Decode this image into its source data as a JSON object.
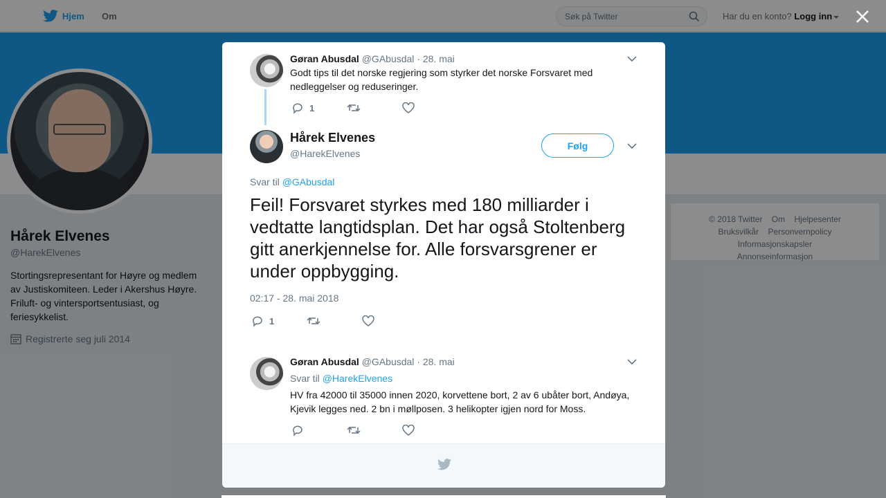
{
  "topbar": {
    "home_label": "Hjem",
    "about_label": "Om",
    "search_placeholder": "Søk på Twitter",
    "account_prompt": "Har du en konto?",
    "login_label": "Logg inn"
  },
  "profile": {
    "name": "Hårek Elvenes",
    "handle": "@HarekElvenes",
    "bio": "Stortingsrepresentant for Høyre og medlem av Justiskomiteen. Leder i Akershus Høyre. Friluft- og vintersportsentusiast, og feriesykkelist.",
    "joined": "Registrerte seg juli 2014"
  },
  "footer_links": [
    "© 2018 Twitter",
    "Om",
    "Hjelpesenter",
    "Bruksvilkår",
    "Personvernpolicy",
    "Informasjonskapsler",
    "Annonseinformasjon"
  ],
  "parent_tweet": {
    "name": "Gøran Abusdal",
    "handle": "@GAbusdal",
    "sep_date": "· 28. mai",
    "text": "Godt tips til det norske regjering som styrker det norske Forsvaret med nedleggelser og reduseringer.",
    "reply_count": "1"
  },
  "main_tweet": {
    "name": "Hårek Elvenes",
    "handle": "@HarekElvenes",
    "follow_label": "Følg",
    "reply_prefix": "Svar til",
    "reply_handle": "@GAbusdal",
    "text": "Feil! Forsvaret styrkes med 180 milliarder i vedtatte langtidsplan. Det har også Stoltenberg gitt anerkjennelse for. Alle forsvarsgrener er under oppbygging.",
    "timestamp": "02:17 - 28. mai 2018",
    "reply_count": "1"
  },
  "reply_tweet": {
    "name": "Gøran Abusdal",
    "handle": "@GAbusdal",
    "sep_date": "· 28. mai",
    "reply_prefix": "Svar til",
    "reply_handle": "@HarekElvenes",
    "text": "HV fra 42000 til 35000 innen 2020, korvettene bort, 2 av 6 ubåter bort, Andøya, Kjevik legges ned. 2 bn i møllposen. 3 helikopter igjen nord for Moss."
  },
  "colors": {
    "brand": "#1da1f2",
    "thread_line": "#a6d8f5"
  }
}
